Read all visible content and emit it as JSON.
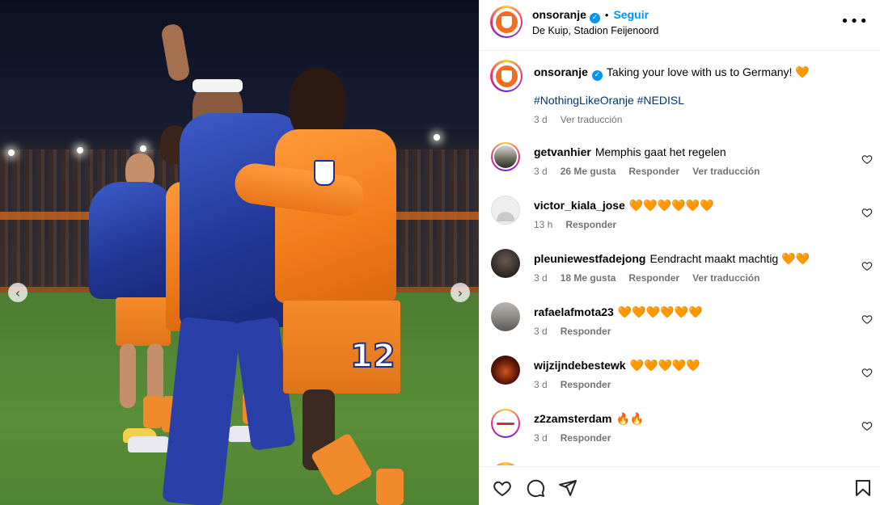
{
  "post": {
    "username": "onsoranje",
    "follow_label": "Seguir",
    "separator": "•",
    "location": "De Kuip, Stadion Feijenoord",
    "more_icon": "more-options-icon",
    "verified_icon": "verified-badge-icon"
  },
  "caption": {
    "username": "onsoranje",
    "text": "Taking your love with us to Germany! 🧡",
    "hashtags": "#NothingLikeOranje #NEDISL",
    "time": "3 d",
    "translate": "Ver traducción"
  },
  "comments": [
    {
      "user": "getvanhier",
      "text": "Memphis gaat het regelen",
      "time": "3 d",
      "likes": "26 Me gusta",
      "reply": "Responder",
      "translate": "Ver traducción"
    },
    {
      "user": "victor_kiala_jose",
      "text": "🧡🧡🧡🧡🧡🧡",
      "time": "13 h",
      "likes": "",
      "reply": "Responder",
      "translate": ""
    },
    {
      "user": "pleuniewestfadejong",
      "text": "Eendracht maakt machtig 🧡🧡",
      "time": "3 d",
      "likes": "18 Me gusta",
      "reply": "Responder",
      "translate": "Ver traducción"
    },
    {
      "user": "rafaelafmota23",
      "text": "🧡🧡🧡🧡🧡🧡",
      "time": "3 d",
      "likes": "",
      "reply": "Responder",
      "translate": ""
    },
    {
      "user": "wijzijndebestewk",
      "text": "🧡🧡🧡🧡🧡",
      "time": "3 d",
      "likes": "",
      "reply": "Responder",
      "translate": ""
    },
    {
      "user": "z2zamsterdam",
      "text": "🔥🔥",
      "time": "3 d",
      "likes": "",
      "reply": "Responder",
      "translate": ""
    }
  ],
  "photo": {
    "jersey_number": "12",
    "prev_icon": "chevron-left-icon",
    "next_icon": "chevron-right-icon"
  },
  "actions": {
    "like_icon": "heart-icon",
    "comment_icon": "comment-icon",
    "share_icon": "share-icon",
    "save_icon": "bookmark-icon"
  },
  "colors": {
    "accent": "#0095f6",
    "hashtag": "#00376b",
    "muted": "#737373",
    "orange": "#f36c21"
  }
}
